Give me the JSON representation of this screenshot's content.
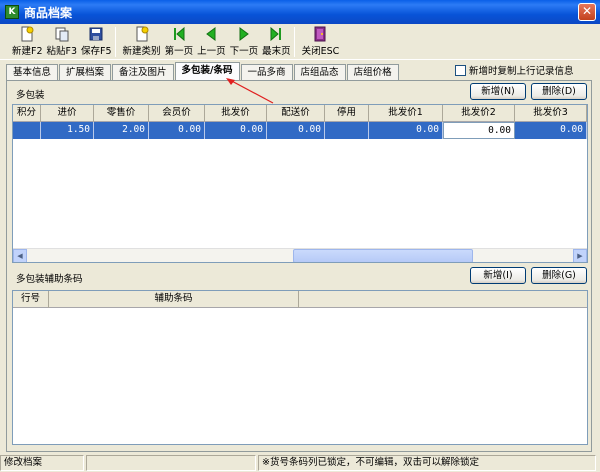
{
  "window": {
    "title": "商品档案",
    "app_icon_glyph": "K",
    "close_glyph": "✕"
  },
  "toolbar": {
    "buttons": [
      {
        "label": "新建F2",
        "icon": "new-doc-icon"
      },
      {
        "label": "粘贴F3",
        "icon": "paste-icon"
      },
      {
        "label": "保存F5",
        "icon": "save-icon"
      },
      {
        "label": "新建类别",
        "icon": "new-category-icon"
      },
      {
        "label": "第一页",
        "icon": "first-page-icon"
      },
      {
        "label": "上一页",
        "icon": "prev-page-icon"
      },
      {
        "label": "下一页",
        "icon": "next-page-icon"
      },
      {
        "label": "最末页",
        "icon": "last-page-icon"
      },
      {
        "label": "关闭ESC",
        "icon": "close-door-icon"
      }
    ]
  },
  "tabs": [
    {
      "label": "基本信息",
      "active": false
    },
    {
      "label": "扩展档案",
      "active": false
    },
    {
      "label": "备注及图片",
      "active": false
    },
    {
      "label": "多包装/条码",
      "active": true
    },
    {
      "label": "一品多商",
      "active": false
    },
    {
      "label": "店组品态",
      "active": false
    },
    {
      "label": "店组价格",
      "active": false
    }
  ],
  "copy_option": {
    "label": "新增时复制上行记录信息",
    "checked": false
  },
  "multi_pack": {
    "section_label": "多包装",
    "add_label": "新增(N)",
    "delete_label": "删除(D)",
    "columns": [
      "积分",
      "进价",
      "零售价",
      "会员价",
      "批发价",
      "配送价",
      "停用",
      "批发价1",
      "批发价2",
      "批发价3"
    ],
    "rows": [
      [
        "",
        "1.50",
        "2.00",
        "0.00",
        "0.00",
        "0.00",
        "",
        "0.00",
        "0.00",
        "0.00"
      ]
    ],
    "scroll_left_glyph": "◀",
    "scroll_right_glyph": "▶"
  },
  "barcode": {
    "section_label": "多包装辅助条码",
    "add_label": "新增(I)",
    "delete_label": "删除(G)",
    "columns": [
      "行号",
      "辅助条码"
    ]
  },
  "status": {
    "left": "修改档案",
    "middle": "",
    "right": "※货号条码列已锁定，不可编辑，双击可以解除锁定"
  },
  "colors": {
    "selection": "#316AC5",
    "annotation": "#E02020"
  }
}
